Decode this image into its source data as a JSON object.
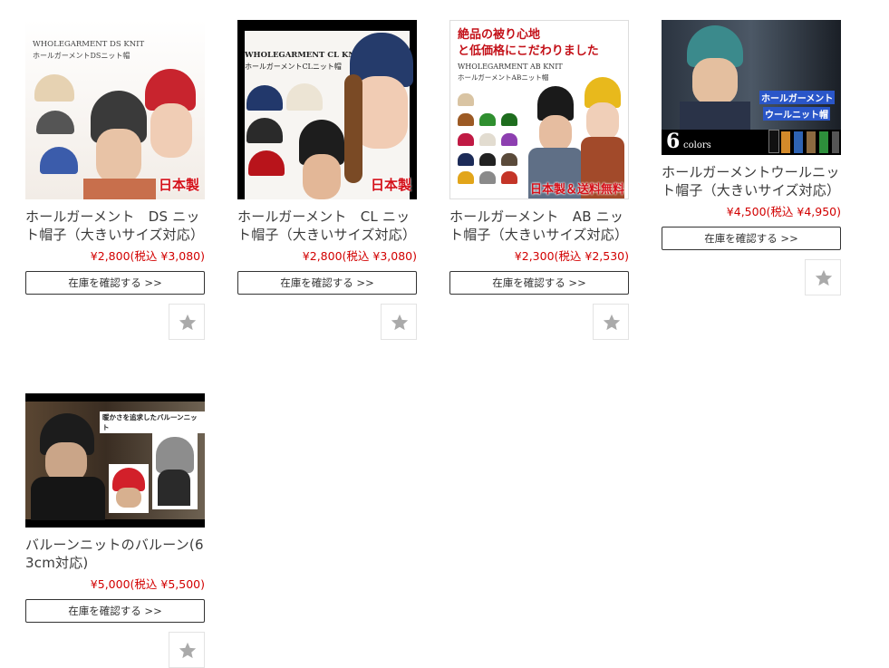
{
  "products": [
    {
      "name": "ホールガーメント　DS ニット帽子（大きいサイズ対応）",
      "price": "¥2,800(税込 ¥3,080)",
      "button_label": "在庫を確認する >>",
      "image_text": [
        "WHOLEGARMENT DS KNIT",
        "ホールガーメントDSニット帽",
        "日本製"
      ]
    },
    {
      "name": "ホールガーメント　CL ニット帽子（大きいサイズ対応）",
      "price": "¥2,800(税込 ¥3,080)",
      "button_label": "在庫を確認する >>",
      "image_text": [
        "WHOLEGARMENT CL KNIT",
        "ホールガーメントCLニット帽",
        "日本製"
      ]
    },
    {
      "name": "ホールガーメント　AB ニット帽子（大きいサイズ対応）",
      "price": "¥2,300(税込 ¥2,530)",
      "button_label": "在庫を確認する >>",
      "image_text": [
        "絶品の被り心地",
        "と低価格にこだわりました",
        "WHOLEGARMENT AB KNIT",
        "ホールガーメントABニット帽",
        "日本製＆送料無料"
      ]
    },
    {
      "name": "ホールガーメントウールニット帽子（大きいサイズ対応）",
      "price": "¥4,500(税込 ¥4,950)",
      "button_label": "在庫を確認する >>",
      "image_text": [
        "ホールガーメント",
        "ウールニット帽",
        "6",
        "colors"
      ]
    },
    {
      "name": "バルーンニットのバルーン(63cm対応)",
      "price": "¥5,000(税込 ¥5,500)",
      "button_label": "在庫を確認する >>",
      "image_text": [
        "暖かさを追求したバルーンニット"
      ]
    }
  ],
  "favorite_icon": "star-icon",
  "colors": {
    "price": "#d20000",
    "text": "#3a3a3a",
    "button_border": "#333333",
    "star": "#aaaaaa"
  }
}
